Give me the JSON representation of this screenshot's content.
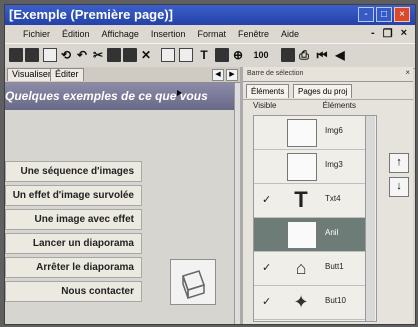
{
  "window": {
    "title": "[Exemple (Première page)]"
  },
  "menu": [
    "Fichier",
    "Édition",
    "Affichage",
    "Insertion",
    "Format",
    "Fenêtre",
    "Aide"
  ],
  "window_controls": [
    "-",
    "□",
    "×"
  ],
  "toolbar": {
    "zoom_text": "100"
  },
  "left_tabs": [
    "Visualiser",
    "Éditer"
  ],
  "header_text": "Quelques exemples de ce que vous",
  "nav_items": [
    "Une séquence d'images",
    "Un effet d'image survolée",
    "Une image avec effet",
    "Lancer un diaporama",
    "Arrêter le diaporama",
    "Nous contacter"
  ],
  "right_panel": {
    "title": "Barre de sélection",
    "tabs": [
      "Éléments",
      "Pages du proj"
    ],
    "columns": [
      "Visible",
      "Éléments"
    ],
    "items": [
      {
        "visible": "",
        "label": "Img6",
        "selected": false,
        "type": "image"
      },
      {
        "visible": "",
        "label": "Img3",
        "selected": false,
        "type": "image"
      },
      {
        "visible": "✓",
        "label": "Txt4",
        "selected": false,
        "type": "text"
      },
      {
        "visible": "",
        "label": "Anil",
        "selected": true,
        "type": "image"
      },
      {
        "visible": "✓",
        "label": "Butt1",
        "selected": false,
        "type": "button"
      },
      {
        "visible": "✓",
        "label": "But10",
        "selected": false,
        "type": "button"
      }
    ]
  }
}
